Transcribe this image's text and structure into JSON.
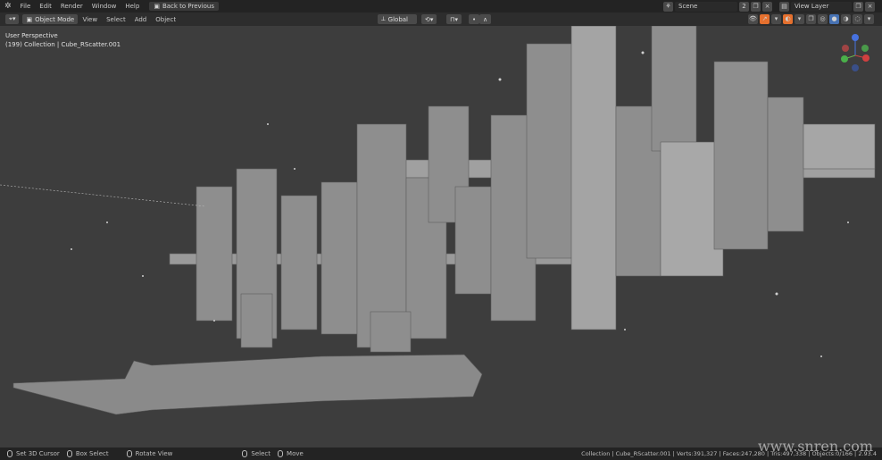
{
  "topbar": {
    "menus": [
      "File",
      "Edit",
      "Render",
      "Window",
      "Help"
    ],
    "back_button": "Back to Previous",
    "scene": "Scene",
    "scene_users": "2",
    "view_layer": "View Layer"
  },
  "header": {
    "mode": "Object Mode",
    "menus": [
      "View",
      "Select",
      "Add",
      "Object"
    ],
    "orientation": "Global"
  },
  "viewport": {
    "perspective": "User Perspective",
    "collection_info": "(199) Collection | Cube_RScatter.001",
    "gizmo": {
      "z": "Z",
      "x": "X",
      "y": "Y"
    }
  },
  "statusbar": {
    "items": [
      "Set 3D Cursor",
      "Box Select",
      "Rotate View",
      "Select",
      "Move"
    ],
    "stats": "Collection | Cube_RScatter.001 | Verts:391,327 | Faces:247,280 | Tris:497,338 | Objects:0/166 | 2.93.4"
  },
  "watermark": "www.snren.com",
  "colors": {
    "accent": "#e5702e",
    "active": "#4772b3"
  }
}
